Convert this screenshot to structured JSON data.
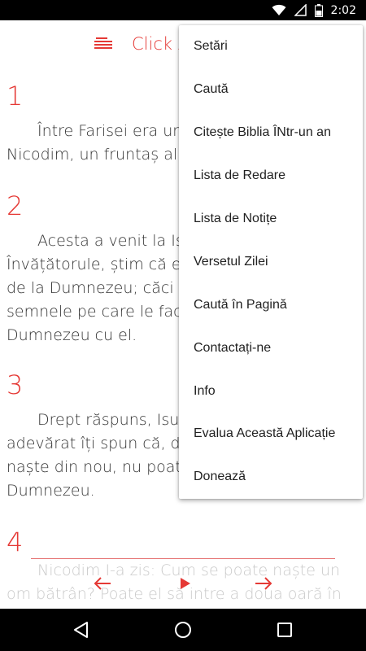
{
  "status_bar": {
    "time": "2:02",
    "icons": [
      "wifi-icon",
      "signal-icon",
      "battery-icon"
    ]
  },
  "toolbar": {
    "title": "Click A",
    "menu_icon": "book-menu-icon"
  },
  "verses": [
    {
      "number": "1",
      "text": "Între Farisei era un\nNicodim, un fruntaș al"
    },
    {
      "number": "2",
      "text": "Acesta a venit la Isus\nÎnvățătorule, știm că eș\nde la Dumnezeu; căci n\nsemnele pe care le faci\nDumnezeu cu el."
    },
    {
      "number": "3",
      "text": "Drept răspuns, Isus\nadevărat îți spun că, da\nnaște din nou, nu poate\nDumnezeu."
    },
    {
      "number": "4",
      "text": ""
    }
  ],
  "faded_text": "Nicodim I-a zis: Cum se poate naște un\nom bătrân? Poate el să intre a doua oară în",
  "reader_controls": {
    "prev_icon": "arrow-left-icon",
    "play_icon": "play-icon",
    "next_icon": "arrow-right-icon"
  },
  "menu": {
    "items": [
      "Setări",
      "Caută",
      "Citește Biblia ÎNtr-un an",
      "Lista de Redare",
      "Lista de Notițe",
      "Versetul Zilei",
      "Caută în Pagină",
      "Contactați-ne",
      "Info",
      "Evalua Această Aplicație",
      "Donează"
    ]
  },
  "colors": {
    "accent": "#e53935",
    "text": "#333333",
    "menu_text": "#212121"
  }
}
